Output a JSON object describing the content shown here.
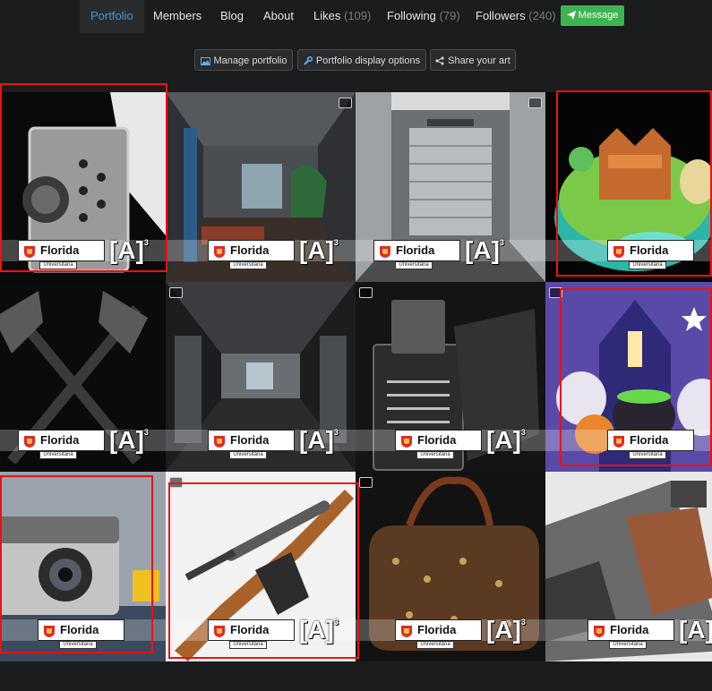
{
  "nav": {
    "tabs": [
      {
        "label": "Portfolio",
        "count": ""
      },
      {
        "label": "Members",
        "count": ""
      },
      {
        "label": "Blog",
        "count": ""
      },
      {
        "label": "About",
        "count": ""
      },
      {
        "label": "Likes",
        "count": "(109)"
      },
      {
        "label": "Following",
        "count": "(79)"
      },
      {
        "label": "Followers",
        "count": "(240)"
      }
    ],
    "message_label": "Message"
  },
  "toolbar": {
    "manage": "Manage portfolio",
    "display": "Portfolio display options",
    "share": "Share your art"
  },
  "watermark": {
    "brand": "Florida",
    "sub": "Universitària",
    "mark": "A",
    "mark_sup": "3"
  },
  "colors": {
    "accent": "#3d9bdf",
    "message_button": "#3db451",
    "selection": "#ee1111"
  },
  "tiles": [
    {
      "subject": "zippo-lighter-closeup",
      "selected": true
    },
    {
      "subject": "sci-fi-interior-lounge",
      "selected": false
    },
    {
      "subject": "sci-fi-hangar-door",
      "selected": false
    },
    {
      "subject": "low-poly-floating-island",
      "selected": true
    },
    {
      "subject": "crossed-tomahawks",
      "selected": false
    },
    {
      "subject": "sci-fi-corridor",
      "selected": false
    },
    {
      "subject": "engraved-zippo-lighter",
      "selected": false
    },
    {
      "subject": "halloween-haunted-house",
      "selected": true
    },
    {
      "subject": "vintage-camera",
      "selected": true
    },
    {
      "subject": "sniper-rifle",
      "selected": true
    },
    {
      "subject": "monogram-duffel-bag",
      "selected": false
    },
    {
      "subject": "assault-rifle-closeup",
      "selected": false
    }
  ]
}
